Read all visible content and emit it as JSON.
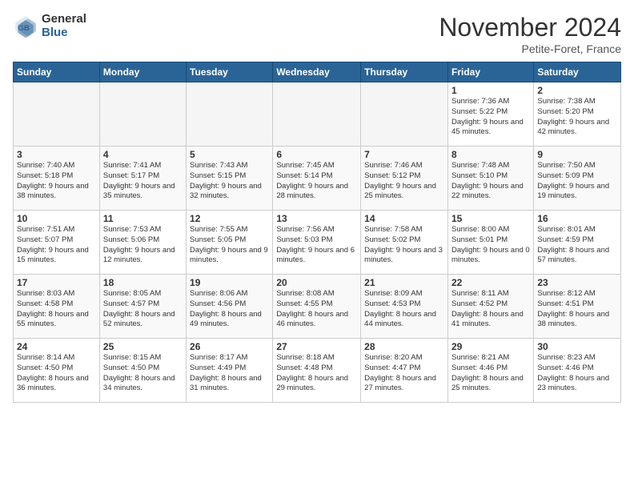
{
  "header": {
    "logo_general": "General",
    "logo_blue": "Blue",
    "month_title": "November 2024",
    "location": "Petite-Foret, France"
  },
  "days_of_week": [
    "Sunday",
    "Monday",
    "Tuesday",
    "Wednesday",
    "Thursday",
    "Friday",
    "Saturday"
  ],
  "weeks": [
    [
      {
        "day": "",
        "empty": true
      },
      {
        "day": "",
        "empty": true
      },
      {
        "day": "",
        "empty": true
      },
      {
        "day": "",
        "empty": true
      },
      {
        "day": "",
        "empty": true
      },
      {
        "day": "1",
        "sunrise": "7:36 AM",
        "sunset": "5:22 PM",
        "daylight": "9 hours and 45 minutes."
      },
      {
        "day": "2",
        "sunrise": "7:38 AM",
        "sunset": "5:20 PM",
        "daylight": "9 hours and 42 minutes."
      }
    ],
    [
      {
        "day": "3",
        "sunrise": "7:40 AM",
        "sunset": "5:18 PM",
        "daylight": "9 hours and 38 minutes."
      },
      {
        "day": "4",
        "sunrise": "7:41 AM",
        "sunset": "5:17 PM",
        "daylight": "9 hours and 35 minutes."
      },
      {
        "day": "5",
        "sunrise": "7:43 AM",
        "sunset": "5:15 PM",
        "daylight": "9 hours and 32 minutes."
      },
      {
        "day": "6",
        "sunrise": "7:45 AM",
        "sunset": "5:14 PM",
        "daylight": "9 hours and 28 minutes."
      },
      {
        "day": "7",
        "sunrise": "7:46 AM",
        "sunset": "5:12 PM",
        "daylight": "9 hours and 25 minutes."
      },
      {
        "day": "8",
        "sunrise": "7:48 AM",
        "sunset": "5:10 PM",
        "daylight": "9 hours and 22 minutes."
      },
      {
        "day": "9",
        "sunrise": "7:50 AM",
        "sunset": "5:09 PM",
        "daylight": "9 hours and 19 minutes."
      }
    ],
    [
      {
        "day": "10",
        "sunrise": "7:51 AM",
        "sunset": "5:07 PM",
        "daylight": "9 hours and 15 minutes."
      },
      {
        "day": "11",
        "sunrise": "7:53 AM",
        "sunset": "5:06 PM",
        "daylight": "9 hours and 12 minutes."
      },
      {
        "day": "12",
        "sunrise": "7:55 AM",
        "sunset": "5:05 PM",
        "daylight": "9 hours and 9 minutes."
      },
      {
        "day": "13",
        "sunrise": "7:56 AM",
        "sunset": "5:03 PM",
        "daylight": "9 hours and 6 minutes."
      },
      {
        "day": "14",
        "sunrise": "7:58 AM",
        "sunset": "5:02 PM",
        "daylight": "9 hours and 3 minutes."
      },
      {
        "day": "15",
        "sunrise": "8:00 AM",
        "sunset": "5:01 PM",
        "daylight": "9 hours and 0 minutes."
      },
      {
        "day": "16",
        "sunrise": "8:01 AM",
        "sunset": "4:59 PM",
        "daylight": "8 hours and 57 minutes."
      }
    ],
    [
      {
        "day": "17",
        "sunrise": "8:03 AM",
        "sunset": "4:58 PM",
        "daylight": "8 hours and 55 minutes."
      },
      {
        "day": "18",
        "sunrise": "8:05 AM",
        "sunset": "4:57 PM",
        "daylight": "8 hours and 52 minutes."
      },
      {
        "day": "19",
        "sunrise": "8:06 AM",
        "sunset": "4:56 PM",
        "daylight": "8 hours and 49 minutes."
      },
      {
        "day": "20",
        "sunrise": "8:08 AM",
        "sunset": "4:55 PM",
        "daylight": "8 hours and 46 minutes."
      },
      {
        "day": "21",
        "sunrise": "8:09 AM",
        "sunset": "4:53 PM",
        "daylight": "8 hours and 44 minutes."
      },
      {
        "day": "22",
        "sunrise": "8:11 AM",
        "sunset": "4:52 PM",
        "daylight": "8 hours and 41 minutes."
      },
      {
        "day": "23",
        "sunrise": "8:12 AM",
        "sunset": "4:51 PM",
        "daylight": "8 hours and 38 minutes."
      }
    ],
    [
      {
        "day": "24",
        "sunrise": "8:14 AM",
        "sunset": "4:50 PM",
        "daylight": "8 hours and 36 minutes."
      },
      {
        "day": "25",
        "sunrise": "8:15 AM",
        "sunset": "4:50 PM",
        "daylight": "8 hours and 34 minutes."
      },
      {
        "day": "26",
        "sunrise": "8:17 AM",
        "sunset": "4:49 PM",
        "daylight": "8 hours and 31 minutes."
      },
      {
        "day": "27",
        "sunrise": "8:18 AM",
        "sunset": "4:48 PM",
        "daylight": "8 hours and 29 minutes."
      },
      {
        "day": "28",
        "sunrise": "8:20 AM",
        "sunset": "4:47 PM",
        "daylight": "8 hours and 27 minutes."
      },
      {
        "day": "29",
        "sunrise": "8:21 AM",
        "sunset": "4:46 PM",
        "daylight": "8 hours and 25 minutes."
      },
      {
        "day": "30",
        "sunrise": "8:23 AM",
        "sunset": "4:46 PM",
        "daylight": "8 hours and 23 minutes."
      }
    ]
  ]
}
